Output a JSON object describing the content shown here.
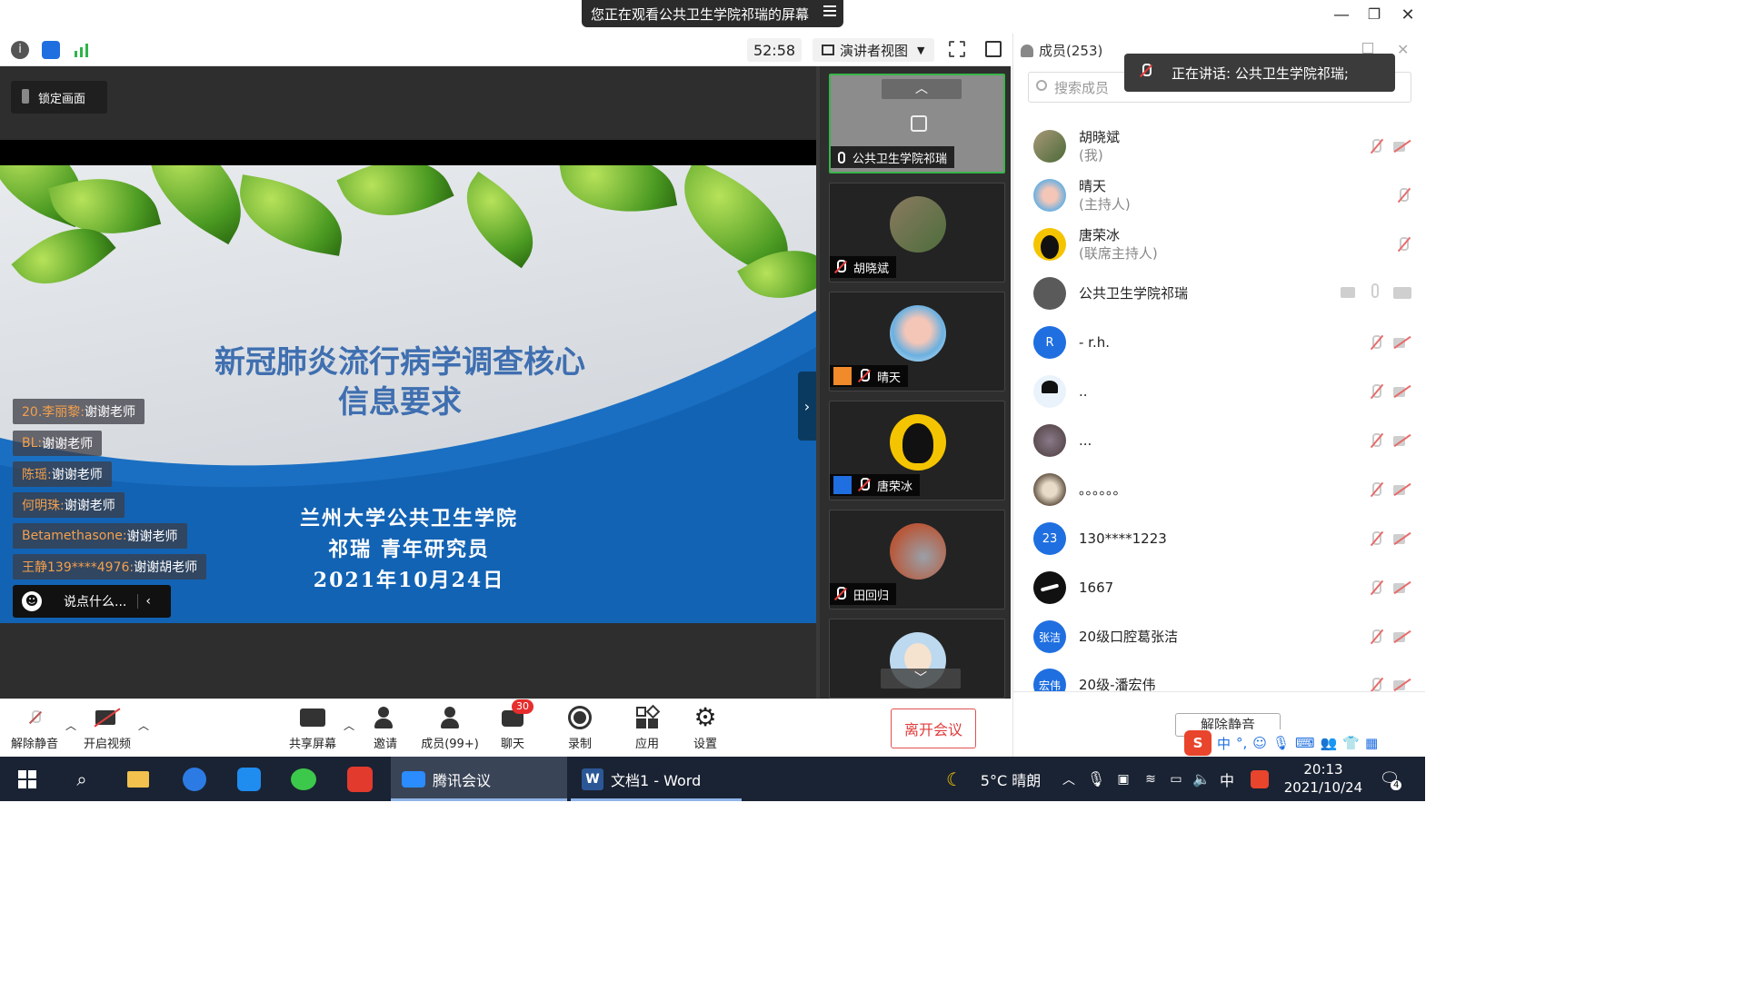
{
  "notice": {
    "text": "您正在观看公共卫生学院祁瑞的屏幕"
  },
  "toolbar": {
    "timer": "52:58",
    "view_label": "演讲者视图"
  },
  "stage": {
    "lock_label": "锁定画面",
    "slide": {
      "title_line1": "新冠肺炎流行病学调查核心",
      "title_line2": "信息要求",
      "org": "兰州大学公共卫生学院",
      "author": "祁瑞 青年研究员",
      "date": "2021年10月24日"
    },
    "chat": [
      {
        "name": "20.李丽黎:",
        "text": " 谢谢老师"
      },
      {
        "name": "BL:",
        "text": " 谢谢老师"
      },
      {
        "name": "陈瑶:",
        "text": " 谢谢老师"
      },
      {
        "name": "何明珠:",
        "text": " 谢谢老师"
      },
      {
        "name": "Betamethasone:",
        "text": " 谢谢老师"
      },
      {
        "name": "王静139****4976:",
        "text": " 谢谢胡老师"
      }
    ],
    "chat_placeholder": "说点什么..."
  },
  "strip": {
    "tiles": [
      {
        "name": "公共卫生学院祁瑞"
      },
      {
        "name": "胡晓斌"
      },
      {
        "name": "晴天"
      },
      {
        "name": "唐荣冰"
      },
      {
        "name": "田回归"
      }
    ]
  },
  "panel": {
    "title": "成员(253)",
    "search_placeholder": "搜索成员",
    "speaking": "正在讲话: 公共卫生学院祁瑞;",
    "members": [
      {
        "name": "胡晓斌",
        "role": "(我)",
        "avatar": ""
      },
      {
        "name": "晴天",
        "role": "(主持人)",
        "avatar": ""
      },
      {
        "name": "唐荣冰",
        "role": "(联席主持人)",
        "avatar": ""
      },
      {
        "name": "公共卫生学院祁瑞",
        "role": "",
        "avatar": ""
      },
      {
        "name": "-  r.h.",
        "role": "",
        "avatar": "R"
      },
      {
        "name": "..",
        "role": "",
        "avatar": ""
      },
      {
        "name": "...",
        "role": "",
        "avatar": ""
      },
      {
        "name": "。。。。。。",
        "role": "",
        "avatar": ""
      },
      {
        "name": "130****1223",
        "role": "",
        "avatar": "23"
      },
      {
        "name": "1667",
        "role": "",
        "avatar": ""
      },
      {
        "name": "20级口腔葛张洁",
        "role": "",
        "avatar": "张洁"
      },
      {
        "name": "20级-潘宏伟",
        "role": "",
        "avatar": "宏伟"
      }
    ],
    "unmute_all": "解除静音"
  },
  "bottom": {
    "unmute": "解除静音",
    "video": "开启视频",
    "share": "共享屏幕",
    "invite": "邀请",
    "members": "成员(99+)",
    "chat": "聊天",
    "chat_badge": "30",
    "record": "录制",
    "apps": "应用",
    "settings": "设置",
    "leave": "离开会议"
  },
  "taskbar": {
    "app1": "腾讯会议",
    "app2": "文档1 - Word",
    "weather": "5°C  晴朗",
    "ime": "中",
    "time": "20:13",
    "date": "2021/10/24",
    "notif": "4"
  },
  "colors": {
    "accent": "#1f6fe0",
    "leave": "#e03c3c",
    "speaking_border": "#39b54a"
  }
}
